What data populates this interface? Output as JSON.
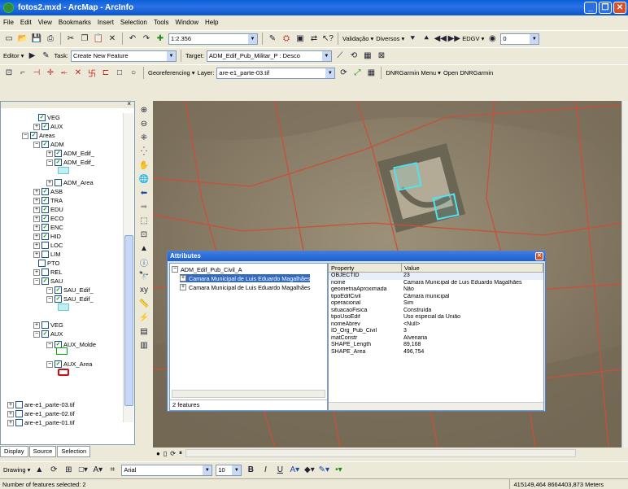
{
  "window": {
    "title": "fotos2.mxd - ArcMap - ArcInfo",
    "min_label": "_",
    "max_label": "❐",
    "close_label": "✕"
  },
  "menu": [
    "File",
    "Edit",
    "View",
    "Bookmarks",
    "Insert",
    "Selection",
    "Tools",
    "Window",
    "Help"
  ],
  "standard_toolbar": {
    "scale": "1:2.356",
    "validacao": "Validação ▾",
    "diversos": "Diversos ▾",
    "edgv": "EDGV ▾",
    "transparency": "0"
  },
  "editor_toolbar": {
    "editor": "Editor ▾",
    "task_label": "Task:",
    "task_value": "Create New Feature",
    "target_label": "Target:",
    "target_value": "ADM_Edif_Pub_Militar_P : Desco"
  },
  "georef_toolbar": {
    "georef": "Georeferencing ▾",
    "layer_label": "Layer:",
    "layer_value": "are-e1_parte-03.tif",
    "dnr_menu": "DNRGarmin Menu ▾",
    "dnr_open": "Open DNRGarmin"
  },
  "toc": {
    "items": [
      {
        "label": "VEG"
      },
      {
        "label": "AUX"
      },
      {
        "label": "Areas"
      },
      {
        "label": "ADM"
      },
      {
        "label": "ADM_Edif_"
      },
      {
        "label": "ADM_Edif_"
      },
      {
        "label": "ADM_Area"
      },
      {
        "label": "ASB"
      },
      {
        "label": "TRA"
      },
      {
        "label": "EDU"
      },
      {
        "label": "ECO"
      },
      {
        "label": "ENC"
      },
      {
        "label": "HID"
      },
      {
        "label": "LOC"
      },
      {
        "label": "LIM"
      },
      {
        "label": "PTO"
      },
      {
        "label": "REL"
      },
      {
        "label": "SAU"
      },
      {
        "label": "SAU_Edif_"
      },
      {
        "label": "SAU_Edif_"
      },
      {
        "label": "VEG"
      },
      {
        "label": "AUX"
      },
      {
        "label": "AUX_Molde"
      },
      {
        "label": "AUX_Area"
      },
      {
        "label": "are-e1_parte-03.tif"
      },
      {
        "label": "are-e1_parte-02.tif"
      },
      {
        "label": "are-e1_parte-01.tif"
      }
    ],
    "tabs": [
      "Display",
      "Source",
      "Selection"
    ]
  },
  "attributes": {
    "title": "Attributes",
    "close": "✕",
    "layer": "ADM_Edif_Pub_Civil_A",
    "features": [
      "Camara Municipal de Luis Eduardo Magalhães",
      "Camara Municipal de Luis Eduardo Magalhães"
    ],
    "count": "2 features",
    "col_property": "Property",
    "col_value": "Value",
    "rows": [
      {
        "k": "OBJECTID",
        "v": "23"
      },
      {
        "k": "nome",
        "v": "Camara Municipal de Luis Eduardo Magalhães"
      },
      {
        "k": "geometriaAproximada",
        "v": "Não"
      },
      {
        "k": "tipoEdifCivil",
        "v": "Câmara municipal"
      },
      {
        "k": "operacional",
        "v": "Sim"
      },
      {
        "k": "situacaoFisica",
        "v": "Construída"
      },
      {
        "k": "tipoUsoEdif",
        "v": "Uso especial da União"
      },
      {
        "k": "nomeAbrev",
        "v": "<Null>"
      },
      {
        "k": "ID_Org_Pub_Civil",
        "v": "3"
      },
      {
        "k": "matConstr",
        "v": "Alvenaria"
      },
      {
        "k": "SHAPE_Length",
        "v": "89,168"
      },
      {
        "k": "SHAPE_Area",
        "v": "496,754"
      }
    ]
  },
  "drawing": {
    "drawing": "Drawing ▾",
    "font": "Arial",
    "size": "10"
  },
  "status": {
    "selected": "Number of features selected: 2",
    "coords": "415149,464  8664403,873 Meters"
  },
  "colors": {
    "selection": "#4ee3f0",
    "road_line": "#c8503a",
    "imagery": "#8a7e62"
  }
}
